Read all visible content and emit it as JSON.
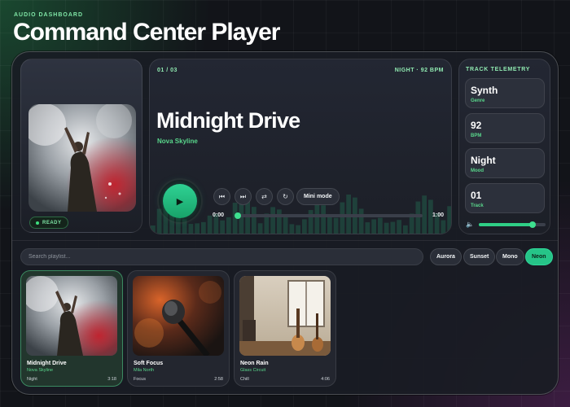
{
  "header": {
    "eyebrow": "AUDIO DASHBOARD",
    "title": "Command Center Player"
  },
  "now_playing": {
    "track_index": "01 / 03",
    "mode_bpm": "NIGHT · 92 BPM",
    "title": "Midnight Drive",
    "artist": "Nova Skyline",
    "status": "READY",
    "time_current": "0:00",
    "time_total": "1:00",
    "progress": 0.0
  },
  "controls": {
    "play_icon": "play-icon",
    "prev_icon": "skip-previous-icon",
    "next_icon": "skip-next-icon",
    "shuffle_icon": "shuffle-icon",
    "repeat_icon": "repeat-icon",
    "mini_mode_label": "Mini mode"
  },
  "telemetry": {
    "title": "TRACK TELEMETRY",
    "items": [
      {
        "value": "Synth",
        "label": "Genre"
      },
      {
        "value": "92",
        "label": "BPM"
      },
      {
        "value": "Night",
        "label": "Mood"
      },
      {
        "value": "01",
        "label": "Track"
      }
    ],
    "volume_icon": "speaker-icon",
    "volume": 0.8
  },
  "playlist": {
    "search_placeholder": "Search playlist...",
    "themes": [
      {
        "label": "Aurora",
        "active": false
      },
      {
        "label": "Sunset",
        "active": false
      },
      {
        "label": "Mono",
        "active": false
      },
      {
        "label": "Neon",
        "active": true
      }
    ],
    "tracks": [
      {
        "title": "Midnight Drive",
        "artist": "Nova Skyline",
        "mood": "Night",
        "duration": "3:18",
        "active": true
      },
      {
        "title": "Soft Focus",
        "artist": "Mila North",
        "mood": "Focus",
        "duration": "2:58",
        "active": false
      },
      {
        "title": "Neon Rain",
        "artist": "Glass Circuit",
        "mood": "Chill",
        "duration": "4:06",
        "active": false
      }
    ]
  },
  "colors": {
    "accent": "#2fcf86",
    "accent_text": "#59d68b",
    "label": "#8fe8b0",
    "background": "#121419"
  }
}
